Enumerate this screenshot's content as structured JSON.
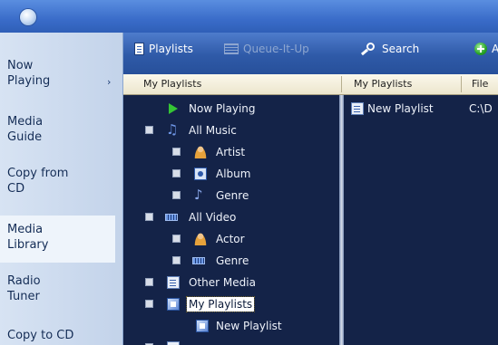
{
  "taskbar": {
    "items": [
      {
        "label": "Now\nPlaying"
      },
      {
        "label": "Media\nGuide"
      },
      {
        "label": "Copy from\nCD"
      },
      {
        "label": "Media\nLibrary"
      },
      {
        "label": "Radio\nTuner"
      },
      {
        "label": "Copy to CD"
      }
    ],
    "expand_arrow": "›"
  },
  "toolbar": {
    "playlists_label": "Playlists",
    "queue_label": "Queue-It-Up",
    "search_label": "Search",
    "add_label": "A"
  },
  "columns": {
    "tree_header": "My Playlists",
    "list_header": "My Playlists",
    "file_header": "File"
  },
  "tree": {
    "now_playing": "Now Playing",
    "all_music": "All Music",
    "artist": "Artist",
    "album": "Album",
    "music_genre": "Genre",
    "all_video": "All Video",
    "actor": "Actor",
    "video_genre": "Genre",
    "other_media": "Other Media",
    "my_playlists": "My Playlists",
    "new_playlist": "New Playlist"
  },
  "list": {
    "rows": [
      {
        "name": "New Playlist",
        "path": "C:\\D"
      }
    ]
  },
  "colors": {
    "pane_background": "#142348",
    "toolbar_blue": "#2f5aa8",
    "taskbar_background": "#c9d8ee",
    "selected_highlight": "#ffffff"
  }
}
